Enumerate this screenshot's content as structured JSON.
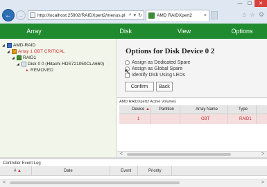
{
  "browser": {
    "url": "http://localhost:25902/RAIDXpert2/menus.pl",
    "tab_title": "AMD RAIDXpert2",
    "tab_close": "×",
    "back": "←",
    "forward": "→",
    "search_glyph": "⌕",
    "dropdown_glyph": "▾",
    "refresh_glyph": "↻",
    "home_glyph": "⌂",
    "favorites_glyph": "☆",
    "settings_glyph": "⚙",
    "minimize": "—",
    "maximize": "☐",
    "close": "✕"
  },
  "header": {
    "array": "Array",
    "disk": "Disk",
    "view": "View",
    "options": "Options"
  },
  "tree": {
    "root": "AMD-RAID",
    "array": "Array 1 GBT CRITICAL",
    "raid": "RAID1",
    "disk": "Disk 0 0 (Hitachi HDS721050CLA660)",
    "removed": "REMOVED"
  },
  "options": {
    "title": "Options for Disk Device 0 2",
    "dedicated": "Assign as Dedicated Spare",
    "global": "Assign as Global Spare",
    "identify": "Identify Disk Using LEDs",
    "confirm": "Confirm",
    "back": "Back"
  },
  "volumes": {
    "title": "AMD RAIDXpert2 Active Volumes",
    "columns": {
      "device": "Device",
      "partition": "Partition",
      "array_name": "Array Name",
      "type": "Type"
    },
    "sort_glyph": "▲",
    "rows": [
      {
        "device": "1",
        "partition": "",
        "array_name": "GBT",
        "type": "RAID1"
      }
    ]
  },
  "event_log": {
    "title": "Controller Event Log",
    "columns": {
      "num": "#",
      "date": "Date",
      "event": "Event",
      "priority": "Priority"
    },
    "sort_glyph": "▲"
  },
  "colors": {
    "header_green": "#1f8a2e",
    "critical_red": "#d3282f",
    "row_highlight": "#f6dede"
  }
}
